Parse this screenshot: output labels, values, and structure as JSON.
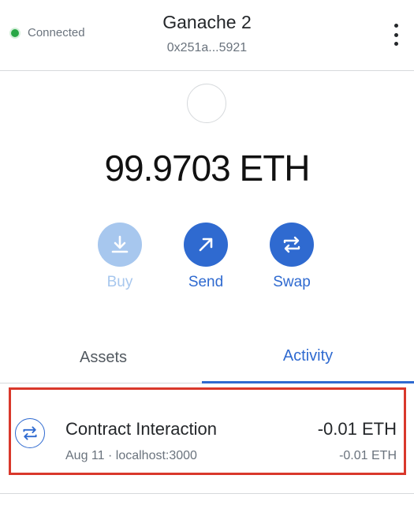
{
  "header": {
    "connection_status": "Connected",
    "account_name": "Ganache 2",
    "account_address": "0x251a...5921",
    "menu_icon": "kebab-menu-icon"
  },
  "balance": {
    "amount": "99.9703 ETH"
  },
  "actions": {
    "buy": {
      "label": "Buy",
      "icon": "download-icon",
      "enabled": false
    },
    "send": {
      "label": "Send",
      "icon": "arrow-up-right-icon",
      "enabled": true
    },
    "swap": {
      "label": "Swap",
      "icon": "swap-arrows-icon",
      "enabled": true
    }
  },
  "tabs": [
    {
      "label": "Assets",
      "active": false
    },
    {
      "label": "Activity",
      "active": true
    }
  ],
  "activity": [
    {
      "title": "Contract Interaction",
      "date": "Aug 11",
      "origin": "localhost:3000",
      "amount_primary": "-0.01 ETH",
      "amount_secondary": "-0.01 ETH",
      "icon": "swap-arrows-icon"
    }
  ],
  "colors": {
    "accent": "#2f6ad0",
    "accent_disabled": "#a7c7ee",
    "connected": "#28a745",
    "highlight_border": "#d9382b"
  }
}
